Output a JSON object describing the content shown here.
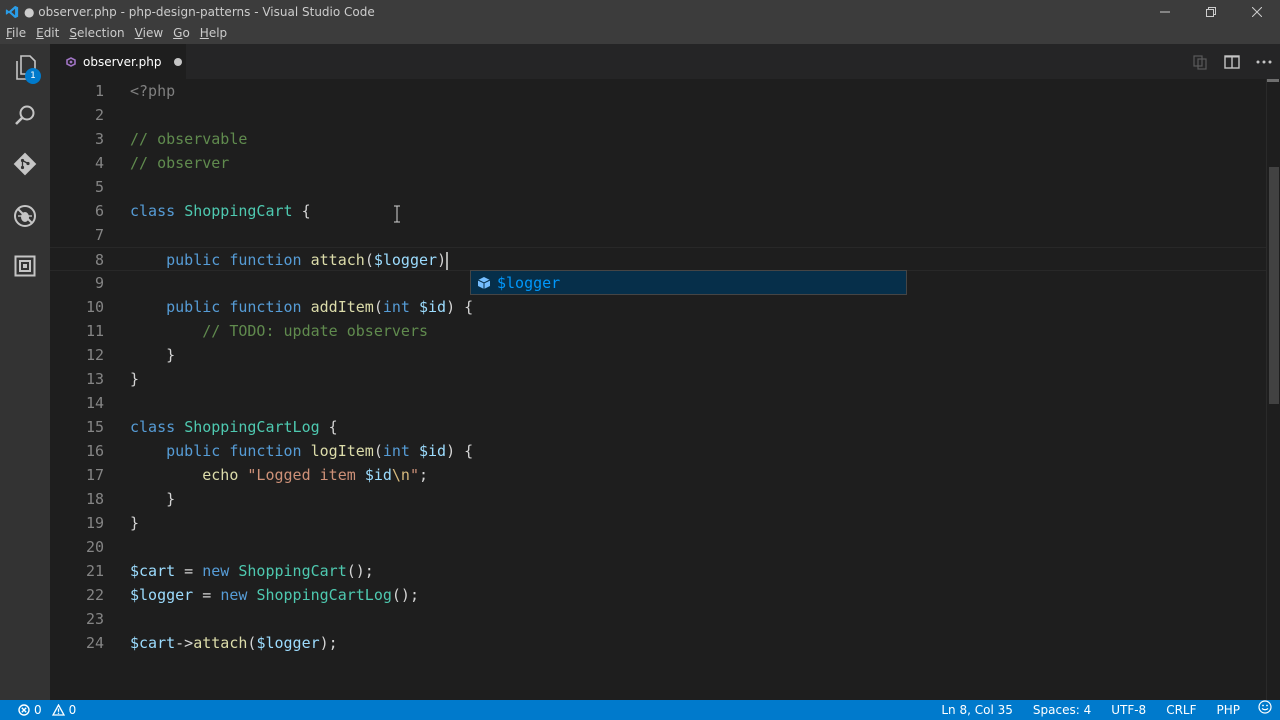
{
  "window": {
    "title": "● observer.php - php-design-patterns - Visual Studio Code"
  },
  "menu": {
    "items": [
      {
        "mnemonic": "F",
        "rest": "ile"
      },
      {
        "mnemonic": "E",
        "rest": "dit"
      },
      {
        "mnemonic": "S",
        "rest": "election"
      },
      {
        "mnemonic": "V",
        "rest": "iew"
      },
      {
        "mnemonic": "G",
        "rest": "o"
      },
      {
        "mnemonic": "H",
        "rest": "elp"
      }
    ]
  },
  "activity_bar": {
    "items": [
      "explorer-icon",
      "search-icon",
      "source-control-icon",
      "debug-icon",
      "extensions-icon"
    ],
    "explorer_badge": "1"
  },
  "tab": {
    "label": "observer.php",
    "dirty": true
  },
  "editor": {
    "lines": [
      {
        "n": "1",
        "tokens": [
          {
            "t": "tag",
            "v": "<?php"
          }
        ]
      },
      {
        "n": "2",
        "tokens": []
      },
      {
        "n": "3",
        "tokens": [
          {
            "t": "cm",
            "v": "// observable"
          }
        ]
      },
      {
        "n": "4",
        "tokens": [
          {
            "t": "cm",
            "v": "// observer"
          }
        ]
      },
      {
        "n": "5",
        "tokens": []
      },
      {
        "n": "6",
        "tokens": [
          {
            "t": "kw",
            "v": "class"
          },
          {
            "t": "pl",
            "v": " "
          },
          {
            "t": "cls",
            "v": "ShoppingCart"
          },
          {
            "t": "pl",
            "v": " {"
          }
        ]
      },
      {
        "n": "7",
        "tokens": []
      },
      {
        "n": "8",
        "current": true,
        "tokens": [
          {
            "t": "pl",
            "v": "    "
          },
          {
            "t": "kw",
            "v": "public"
          },
          {
            "t": "pl",
            "v": " "
          },
          {
            "t": "kw",
            "v": "function"
          },
          {
            "t": "pl",
            "v": " "
          },
          {
            "t": "fn",
            "v": "attach"
          },
          {
            "t": "pl",
            "v": "("
          },
          {
            "t": "var",
            "v": "$logger"
          },
          {
            "t": "pl",
            "v": ")"
          }
        ]
      },
      {
        "n": "9",
        "tokens": []
      },
      {
        "n": "10",
        "tokens": [
          {
            "t": "pl",
            "v": "    "
          },
          {
            "t": "kw",
            "v": "public"
          },
          {
            "t": "pl",
            "v": " "
          },
          {
            "t": "kw",
            "v": "function"
          },
          {
            "t": "pl",
            "v": " "
          },
          {
            "t": "fn",
            "v": "addItem"
          },
          {
            "t": "pl",
            "v": "("
          },
          {
            "t": "kw",
            "v": "int"
          },
          {
            "t": "pl",
            "v": " "
          },
          {
            "t": "var",
            "v": "$id"
          },
          {
            "t": "pl",
            "v": ") {"
          }
        ]
      },
      {
        "n": "11",
        "tokens": [
          {
            "t": "pl",
            "v": "        "
          },
          {
            "t": "cm",
            "v": "// TODO: update observers"
          }
        ]
      },
      {
        "n": "12",
        "tokens": [
          {
            "t": "pl",
            "v": "    }"
          }
        ]
      },
      {
        "n": "13",
        "tokens": [
          {
            "t": "pl",
            "v": "}"
          }
        ]
      },
      {
        "n": "14",
        "tokens": []
      },
      {
        "n": "15",
        "tokens": [
          {
            "t": "kw",
            "v": "class"
          },
          {
            "t": "pl",
            "v": " "
          },
          {
            "t": "cls",
            "v": "ShoppingCartLog"
          },
          {
            "t": "pl",
            "v": " {"
          }
        ]
      },
      {
        "n": "16",
        "tokens": [
          {
            "t": "pl",
            "v": "    "
          },
          {
            "t": "kw",
            "v": "public"
          },
          {
            "t": "pl",
            "v": " "
          },
          {
            "t": "kw",
            "v": "function"
          },
          {
            "t": "pl",
            "v": " "
          },
          {
            "t": "fn",
            "v": "logItem"
          },
          {
            "t": "pl",
            "v": "("
          },
          {
            "t": "kw",
            "v": "int"
          },
          {
            "t": "pl",
            "v": " "
          },
          {
            "t": "var",
            "v": "$id"
          },
          {
            "t": "pl",
            "v": ") {"
          }
        ]
      },
      {
        "n": "17",
        "tokens": [
          {
            "t": "pl",
            "v": "        "
          },
          {
            "t": "fn",
            "v": "echo"
          },
          {
            "t": "pl",
            "v": " "
          },
          {
            "t": "str",
            "v": "\"Logged item "
          },
          {
            "t": "var",
            "v": "$id"
          },
          {
            "t": "esc",
            "v": "\\n"
          },
          {
            "t": "str",
            "v": "\""
          },
          {
            "t": "pl",
            "v": ";"
          }
        ]
      },
      {
        "n": "18",
        "tokens": [
          {
            "t": "pl",
            "v": "    }"
          }
        ]
      },
      {
        "n": "19",
        "tokens": [
          {
            "t": "pl",
            "v": "}"
          }
        ]
      },
      {
        "n": "20",
        "tokens": []
      },
      {
        "n": "21",
        "tokens": [
          {
            "t": "var",
            "v": "$cart"
          },
          {
            "t": "pl",
            "v": " = "
          },
          {
            "t": "kw",
            "v": "new"
          },
          {
            "t": "pl",
            "v": " "
          },
          {
            "t": "cls",
            "v": "ShoppingCart"
          },
          {
            "t": "pl",
            "v": "();"
          }
        ]
      },
      {
        "n": "22",
        "tokens": [
          {
            "t": "var",
            "v": "$logger"
          },
          {
            "t": "pl",
            "v": " = "
          },
          {
            "t": "kw",
            "v": "new"
          },
          {
            "t": "pl",
            "v": " "
          },
          {
            "t": "cls",
            "v": "ShoppingCartLog"
          },
          {
            "t": "pl",
            "v": "();"
          }
        ]
      },
      {
        "n": "23",
        "tokens": []
      },
      {
        "n": "24",
        "tokens": [
          {
            "t": "var",
            "v": "$cart"
          },
          {
            "t": "pl",
            "v": "->"
          },
          {
            "t": "fn",
            "v": "attach"
          },
          {
            "t": "pl",
            "v": "("
          },
          {
            "t": "var",
            "v": "$logger"
          },
          {
            "t": "pl",
            "v": ");"
          }
        ]
      }
    ]
  },
  "suggest": {
    "label": "$logger",
    "kind_icon": "variable-cube-icon"
  },
  "status_bar": {
    "errors": "0",
    "warnings": "0",
    "position": "Ln 8, Col 35",
    "indent": "Spaces: 4",
    "encoding": "UTF-8",
    "eol": "CRLF",
    "language": "PHP"
  },
  "colors": {
    "accent": "#007acc",
    "keyword": "#569cd6",
    "class": "#4ec9b0",
    "function": "#dcdcaa",
    "variable": "#9cdcfe",
    "string": "#ce9178",
    "comment": "#608b4e"
  }
}
